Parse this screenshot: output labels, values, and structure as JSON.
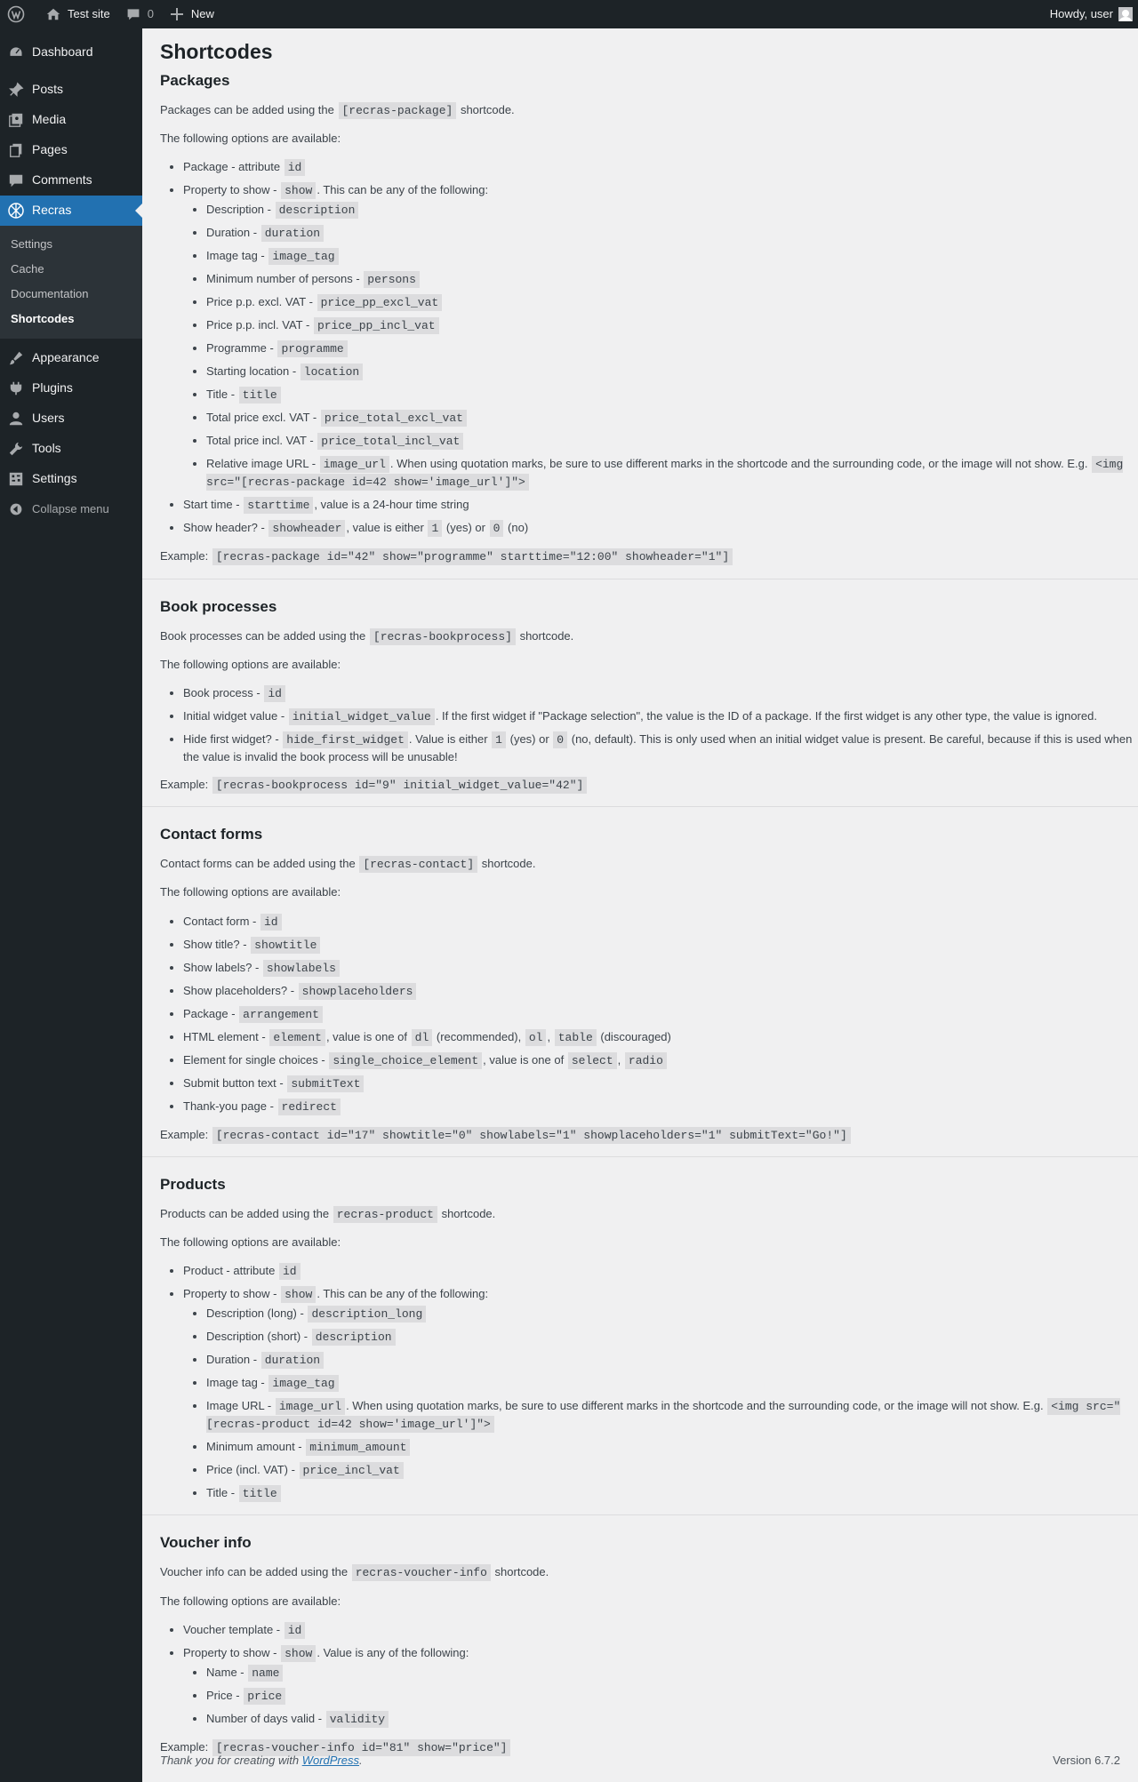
{
  "adminbar": {
    "site_name": "Test site",
    "comments_count": "0",
    "new_label": "New",
    "howdy": "Howdy, user"
  },
  "sidebar": {
    "items_top": [
      {
        "label": "Dashboard",
        "icon": "dashboard-icon"
      },
      {
        "label": "Posts",
        "icon": "pin-icon"
      },
      {
        "label": "Media",
        "icon": "media-icon"
      },
      {
        "label": "Pages",
        "icon": "pages-icon"
      },
      {
        "label": "Comments",
        "icon": "comment-icon"
      },
      {
        "label": "Recras",
        "icon": "recras-icon"
      }
    ],
    "submenu": [
      "Settings",
      "Cache",
      "Documentation",
      "Shortcodes"
    ],
    "items_bottom": [
      {
        "label": "Appearance",
        "icon": "brush-icon"
      },
      {
        "label": "Plugins",
        "icon": "plug-icon"
      },
      {
        "label": "Users",
        "icon": "user-icon"
      },
      {
        "label": "Tools",
        "icon": "wrench-icon"
      },
      {
        "label": "Settings",
        "icon": "settings-icon"
      }
    ],
    "collapse": "Collapse menu",
    "accent": "#2271b1"
  },
  "page": {
    "title": "Shortcodes",
    "options_intro": "The following options are available:",
    "example_label": "Example:",
    "packages": {
      "title": "Packages",
      "intro_pre": "Packages can be added using the",
      "intro_code": "[recras-package]",
      "intro_post": "shortcode.",
      "li_id_label": "Package - attribute",
      "li_id_code": "id",
      "li_show_label": "Property to show -",
      "li_show_code": "show",
      "li_show_post": ". This can be any of the following:",
      "props": [
        {
          "label": "Description -",
          "code": "description"
        },
        {
          "label": "Duration -",
          "code": "duration"
        },
        {
          "label": "Image tag -",
          "code": "image_tag"
        },
        {
          "label": "Minimum number of persons -",
          "code": "persons"
        },
        {
          "label": "Price p.p. excl. VAT -",
          "code": "price_pp_excl_vat"
        },
        {
          "label": "Price p.p. incl. VAT -",
          "code": "price_pp_incl_vat"
        },
        {
          "label": "Programme -",
          "code": "programme"
        },
        {
          "label": "Starting location -",
          "code": "location"
        },
        {
          "label": "Title -",
          "code": "title"
        },
        {
          "label": "Total price excl. VAT -",
          "code": "price_total_excl_vat"
        },
        {
          "label": "Total price incl. VAT -",
          "code": "price_total_incl_vat"
        }
      ],
      "img_label": "Relative image URL -",
      "img_code": "image_url",
      "img_text": ". When using quotation marks, be sure to use different marks in the shortcode and the surrounding code, or the image will not show. E.g.",
      "img_example": "<img src=\"[recras-package id=42 show='image_url']\">",
      "start_label": "Start time -",
      "start_code": "starttime",
      "start_post": ", value is a 24-hour time string",
      "header_label": "Show header? -",
      "header_code": "showheader",
      "header_mid": ", value is either",
      "header_yes": "1",
      "header_yes_txt": "(yes) or",
      "header_no": "0",
      "header_no_txt": "(no)",
      "example": "[recras-package id=\"42\" show=\"programme\" starttime=\"12:00\" showheader=\"1\"]"
    },
    "book": {
      "title": "Book processes",
      "intro_pre": "Book processes can be added using the",
      "intro_code": "[recras-bookprocess]",
      "intro_post": "shortcode.",
      "li1_label": "Book process -",
      "li1_code": "id",
      "li2_label": "Initial widget value -",
      "li2_code": "initial_widget_value",
      "li2_post": ". If the first widget if \"Package selection\", the value is the ID of a package. If the first widget is any other type, the value is ignored.",
      "li3_label": "Hide first widget? -",
      "li3_code": "hide_first_widget",
      "li3_mid": ". Value is either",
      "li3_yes": "1",
      "li3_yes_txt": "(yes) or",
      "li3_no": "0",
      "li3_post": "(no, default). This is only used when an initial widget value is present. Be careful, because if this is used when the value is invalid the book process will be unusable!",
      "example": "[recras-bookprocess id=\"9\" initial_widget_value=\"42\"]"
    },
    "contact": {
      "title": "Contact forms",
      "intro_pre": "Contact forms can be added using the",
      "intro_code": "[recras-contact]",
      "intro_post": "shortcode.",
      "items": [
        {
          "label": "Contact form -",
          "code": "id"
        },
        {
          "label": "Show title? -",
          "code": "showtitle"
        },
        {
          "label": "Show labels? -",
          "code": "showlabels"
        },
        {
          "label": "Show placeholders? -",
          "code": "showplaceholders"
        },
        {
          "label": "Package -",
          "code": "arrangement"
        }
      ],
      "html_label": "HTML element -",
      "html_code": "element",
      "html_mid": ", value is one of",
      "html_dl": "dl",
      "html_rec": "(recommended),",
      "html_ol": "ol",
      "html_comma": ",",
      "html_table": "table",
      "html_disc": "(discouraged)",
      "single_label": "Element for single choices -",
      "single_code": "single_choice_element",
      "single_mid": ", value is one of",
      "single_select": "select",
      "single_comma": ",",
      "single_radio": "radio",
      "items2": [
        {
          "label": "Submit button text -",
          "code": "submitText"
        },
        {
          "label": "Thank-you page -",
          "code": "redirect"
        }
      ],
      "example": "[recras-contact id=\"17\" showtitle=\"0\" showlabels=\"1\" showplaceholders=\"1\" submitText=\"Go!\"]"
    },
    "products": {
      "title": "Products",
      "intro_pre": "Products can be added using the",
      "intro_code": "recras-product",
      "intro_post": "shortcode.",
      "li_id_label": "Product - attribute",
      "li_id_code": "id",
      "li_show_label": "Property to show -",
      "li_show_code": "show",
      "li_show_post": ". This can be any of the following:",
      "props_a": [
        {
          "label": "Description (long) -",
          "code": "description_long"
        },
        {
          "label": "Description (short) -",
          "code": "description"
        },
        {
          "label": "Duration -",
          "code": "duration"
        },
        {
          "label": "Image tag -",
          "code": "image_tag"
        }
      ],
      "img_label": "Image URL -",
      "img_code": "image_url",
      "img_text": ". When using quotation marks, be sure to use different marks in the shortcode and the surrounding code, or the image will not show. E.g.",
      "img_example": "<img src=\"[recras-product id=42 show='image_url']\">",
      "props_b": [
        {
          "label": "Minimum amount -",
          "code": "minimum_amount"
        },
        {
          "label": "Price (incl. VAT) -",
          "code": "price_incl_vat"
        },
        {
          "label": "Title -",
          "code": "title"
        }
      ]
    },
    "voucher": {
      "title": "Voucher info",
      "intro_pre": "Voucher info can be added using the",
      "intro_code": "recras-voucher-info",
      "intro_post": "shortcode.",
      "li_id_label": "Voucher template -",
      "li_id_code": "id",
      "li_show_label": "Property to show -",
      "li_show_code": "show",
      "li_show_post": ". Value is any of the following:",
      "props": [
        {
          "label": "Name -",
          "code": "name"
        },
        {
          "label": "Price -",
          "code": "price"
        },
        {
          "label": "Number of days valid -",
          "code": "validity"
        }
      ],
      "example": "[recras-voucher-info id=\"81\" show=\"price\"]"
    }
  },
  "footer": {
    "thanks_pre": "Thank you for creating with",
    "thanks_link": "WordPress",
    "thanks_post": ".",
    "version": "Version 6.7.2"
  }
}
